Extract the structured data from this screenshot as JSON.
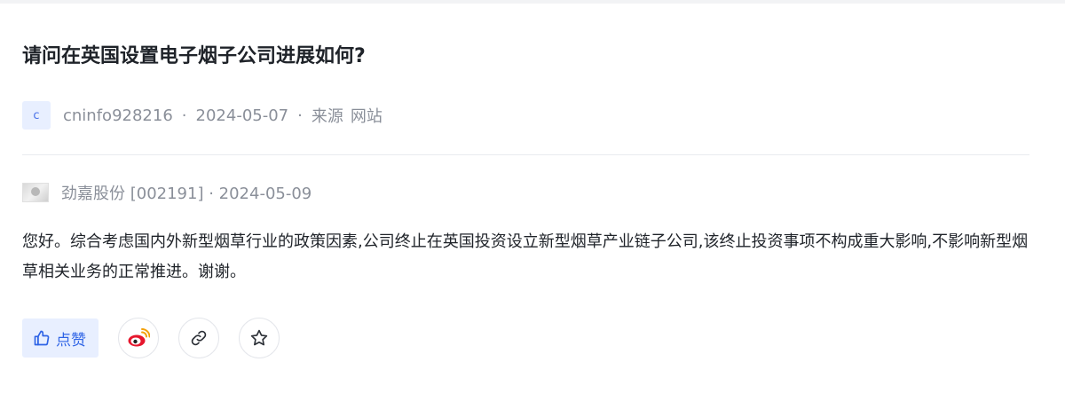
{
  "question": {
    "title": "请问在英国设置电子烟子公司进展如何?",
    "author_avatar_letter": "c",
    "author": "cninfo928216",
    "date": "2024-05-07",
    "source_label": "来源",
    "source_value": "网站"
  },
  "answer": {
    "company_meta": "劲嘉股份 [002191] · 2024-05-09",
    "body": "您好。综合考虑国内外新型烟草行业的政策因素,公司终止在英国投资设立新型烟草产业链子公司,该终止投资事项不构成重大影响,不影响新型烟草相关业务的正常推进。谢谢。"
  },
  "actions": {
    "like_label": "点赞",
    "like_icon": "thumbs-up-icon",
    "share_weibo_icon": "weibo-icon",
    "copy_link_icon": "link-icon",
    "favorite_icon": "star-icon"
  },
  "colors": {
    "accent": "#2f64e6",
    "accent_bg": "#e8efff",
    "muted_text": "#8a8f99",
    "primary_text": "#1f2329",
    "weibo_red": "#e6162d",
    "weibo_orange": "#f3a10b"
  }
}
